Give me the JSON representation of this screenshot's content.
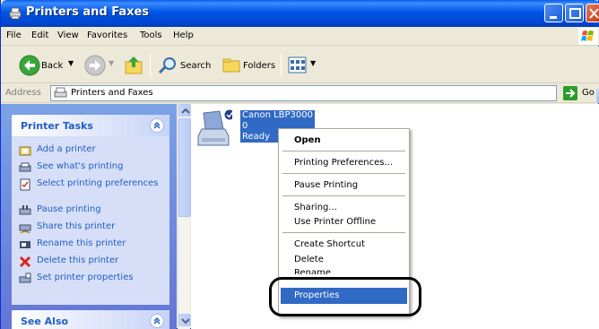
{
  "window": {
    "title": "Printers and Faxes"
  },
  "menubar": {
    "items": [
      "File",
      "Edit",
      "View",
      "Favorites",
      "Tools",
      "Help"
    ]
  },
  "toolbar": {
    "back_label": "Back",
    "search_label": "Search",
    "folders_label": "Folders"
  },
  "address": {
    "label": "Address",
    "value": "Printers and Faxes",
    "go_label": "Go"
  },
  "taskpane": {
    "printer_tasks_title": "Printer Tasks",
    "tasks": [
      "Add a printer",
      "See what's printing",
      "Select printing preferences",
      "Pause printing",
      "Share this printer",
      "Rename this printer",
      "Delete this printer",
      "Set printer properties"
    ],
    "see_also_title": "See Also"
  },
  "printer": {
    "name": "Canon LBP3000",
    "count": "0",
    "status": "Ready"
  },
  "context_menu": {
    "open": "Open",
    "printing_preferences": "Printing Preferences...",
    "pause_printing": "Pause Printing",
    "sharing": "Sharing...",
    "use_offline": "Use Printer Offline",
    "create_shortcut": "Create Shortcut",
    "delete": "Delete",
    "rename": "Rename",
    "properties": "Properties"
  },
  "colors": {
    "titlebar": "#0055E5",
    "selection": "#316AC5",
    "task_link": "#215DC6"
  },
  "icons": [
    "printer-fax-icon",
    "back-arrow-icon",
    "forward-arrow-icon",
    "up-folder-icon",
    "search-icon",
    "folders-icon",
    "views-icon",
    "windows-logo-icon",
    "go-arrow-icon",
    "printer-icon",
    "default-check-icon"
  ]
}
